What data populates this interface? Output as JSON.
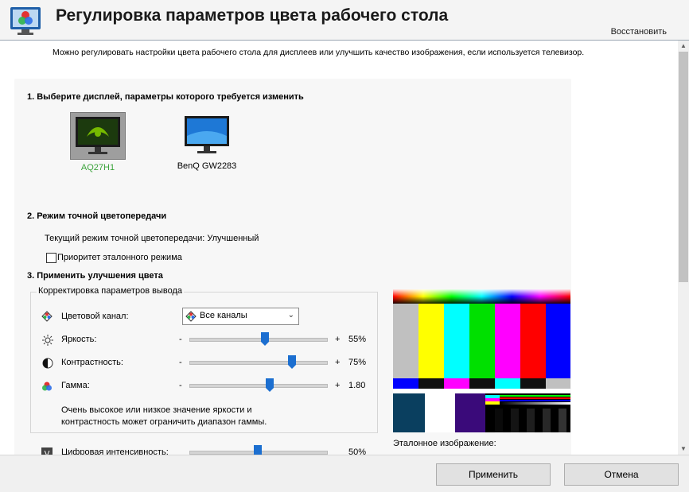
{
  "header": {
    "title": "Регулировка параметров цвета рабочего стола",
    "restore_link": "Восстановить"
  },
  "description": "Можно регулировать настройки цвета рабочего стола для дисплеев или улучшить качество изображения, если используется телевизор.",
  "section1": {
    "title": "1. Выберите дисплей, параметры которого требуется изменить",
    "displays": [
      {
        "name": "AQ27H1",
        "selected": true
      },
      {
        "name": "BenQ GW2283",
        "selected": false
      }
    ]
  },
  "section2": {
    "title": "2. Режим точной цветопередачи",
    "current_mode": "Текущий режим точной цветопередачи: Улучшенный",
    "reference_priority_label": "Приоритет эталонного режима",
    "reference_priority_checked": false
  },
  "section3": {
    "title": "3. Применить улучшения цвета",
    "group_title": "Корректировка параметров вывода",
    "channel_label": "Цветовой канал:",
    "channel_value": "Все каналы",
    "sliders": [
      {
        "label": "Яркость:",
        "minus": "-",
        "plus": "+",
        "value_text": "55%",
        "level": 0.55
      },
      {
        "label": "Контрастность:",
        "minus": "-",
        "plus": "+",
        "value_text": "75%",
        "level": 0.75
      },
      {
        "label": "Гамма:",
        "minus": "-",
        "plus": "+",
        "value_text": "1.80",
        "level": 0.59
      }
    ],
    "note": "Очень высокое или низкое значение яркости и контрастность может ограничить диапазон гаммы.",
    "digital_vibrance": {
      "label": "Цифровая интенсивность:",
      "value_text": "50%",
      "level": 0.5
    },
    "reference_image_label": "Эталонное изображение:"
  },
  "buttons": {
    "apply": "Применить",
    "cancel": "Отмена"
  },
  "colors": {
    "accent_green": "#3aa33a",
    "slider_thumb": "#1c6fd0",
    "header_bg": "#f4f4f4"
  }
}
